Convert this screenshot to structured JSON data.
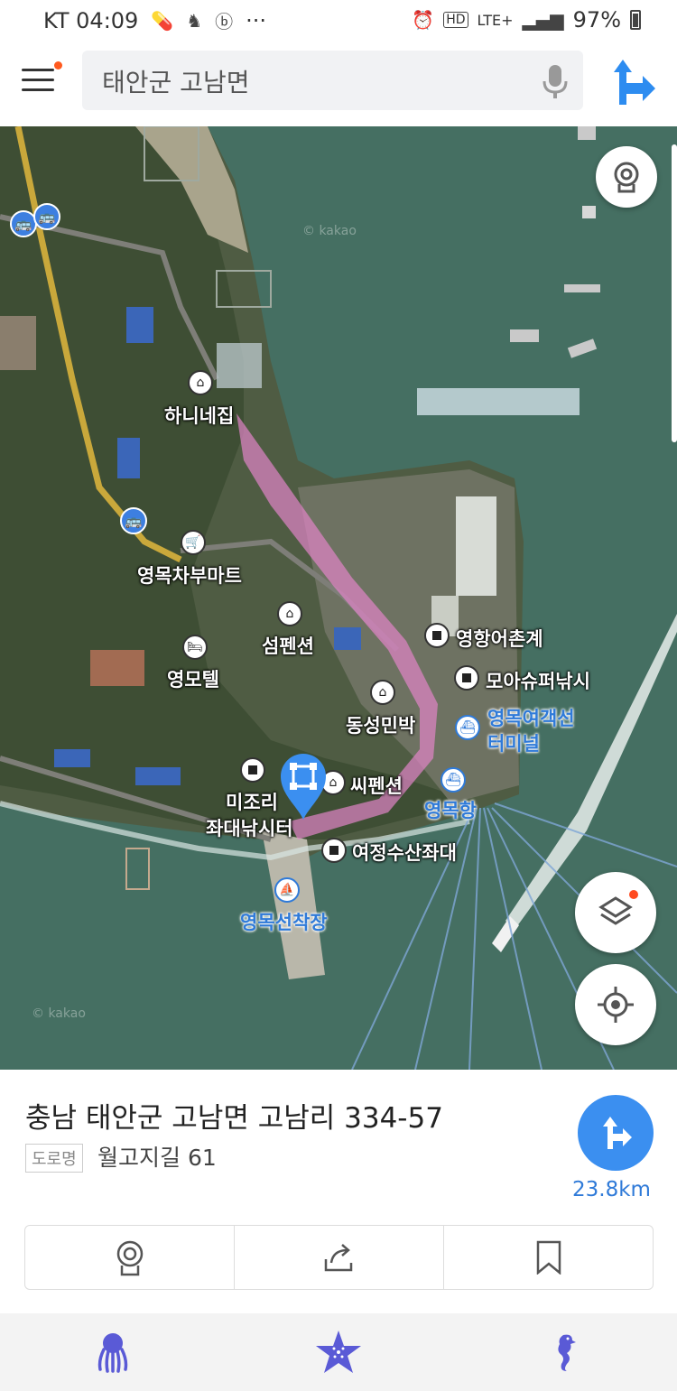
{
  "status_bar": {
    "carrier_time": "KT 04:09",
    "more": "···",
    "hd": "HD",
    "network": "LTE+",
    "battery": "97%"
  },
  "search": {
    "value": "태안군 고남면",
    "menu_icon": "hamburger-menu-icon",
    "mic_icon": "microphone-icon",
    "route_icon": "directions-icon",
    "notification_color": "#ff5a1f"
  },
  "map": {
    "watermark": "© kakao",
    "labels": {
      "hanine": "하니네집",
      "yeongmok_mart": "영목차부마트",
      "seom_pension": "섬펜션",
      "yeongmok_motel": "영모텔",
      "yeonghang": "영항어촌계",
      "moa_fishing": "모아슈퍼낚시",
      "dongseong": "동성민박",
      "terminal_line1": "영목여객선",
      "terminal_line2": "터미널",
      "c_pension": "씨펜션",
      "yeongmok_port": "영목항",
      "mijori_line1": "미조리",
      "mijori_line2": "좌대낚시터",
      "yeojeong": "여정수산좌대",
      "ferry_dock": "영목선착장"
    },
    "buttons": {
      "roadview_icon": "roadview-icon",
      "layers_icon": "layers-icon",
      "location_icon": "my-location-icon"
    },
    "route_color": "#e184c8",
    "label_blue": "#2f7ad8"
  },
  "place": {
    "address": "충남 태안군 고남면 고남리 334-57",
    "road_tag": "도로명",
    "road_address": "월고지길 61",
    "distance": "23.8km",
    "nav_color": "#3b8ff0"
  },
  "actions": {
    "roadview_icon": "roadview-icon",
    "share_icon": "share-icon",
    "bookmark_icon": "bookmark-icon"
  },
  "bottom_nav": {
    "items": [
      "octopus-icon",
      "starfish-icon",
      "seahorse-icon"
    ],
    "color": "#5a5ad6"
  }
}
